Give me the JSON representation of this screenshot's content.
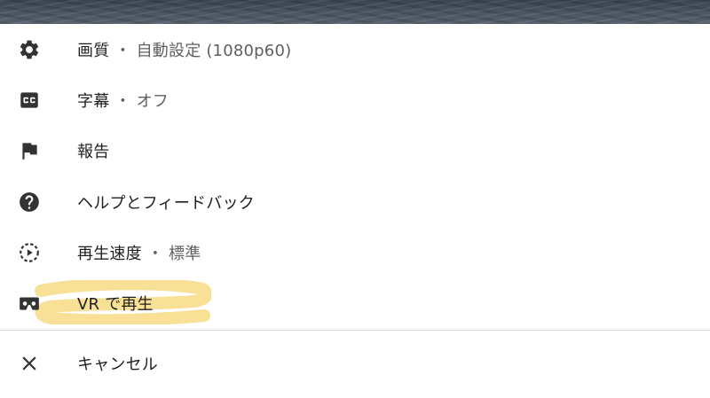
{
  "menu": {
    "items": [
      {
        "id": "quality",
        "icon": "gear-icon",
        "label": "画質",
        "separator": "・",
        "value": "自動設定 (1080p60)"
      },
      {
        "id": "captions",
        "icon": "closed-captions-icon",
        "label": "字幕",
        "separator": "・",
        "value": "オフ"
      },
      {
        "id": "report",
        "icon": "flag-icon",
        "label": "報告"
      },
      {
        "id": "help",
        "icon": "help-icon",
        "label": "ヘルプとフィードバック"
      },
      {
        "id": "speed",
        "icon": "playback-speed-icon",
        "label": "再生速度",
        "separator": "・",
        "value": "標準"
      },
      {
        "id": "vr",
        "icon": "vr-headset-icon",
        "label": "VR で再生"
      }
    ],
    "cancel": {
      "icon": "close-icon",
      "label": "キャンセル"
    }
  },
  "colors": {
    "text": "#1f1f1f",
    "secondary_text": "#5f5f5f",
    "icon": "#333333",
    "highlight": "#f5d36a",
    "divider": "#dcdcdc"
  }
}
